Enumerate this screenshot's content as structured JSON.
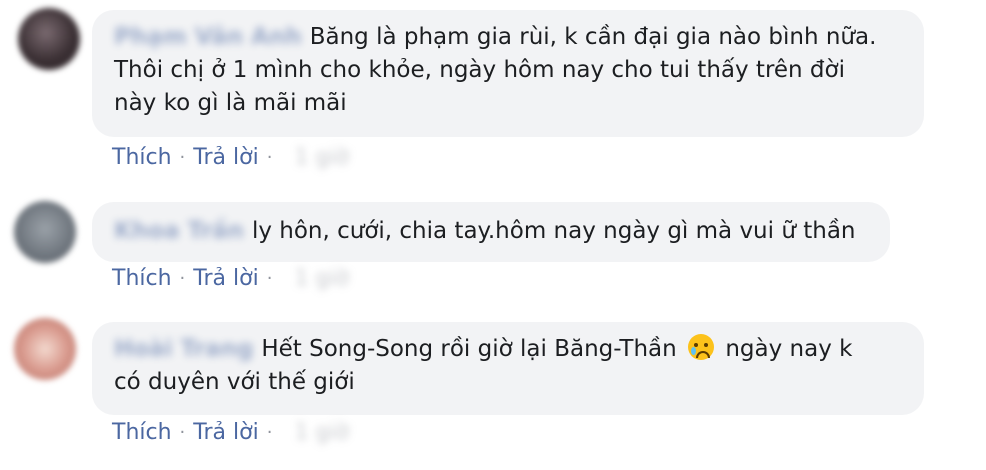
{
  "comments": [
    {
      "author": "Phạm Vân Anh",
      "text_lines": [
        "Băng là phạm gia rùi, k cần đại gia nào bình nữa.",
        "Thôi chị ở 1 mình cho khỏe, ngày hôm nay cho tui thấy trên đời",
        "này ko gì là mãi mãi"
      ],
      "like_label": "Thích",
      "reply_label": "Trả lời",
      "time": "1 giờ"
    },
    {
      "author": "Khoa Trần",
      "text_lines": [
        "ly hôn, cưới, chia tay.hôm nay ngày gì mà vui ữ thần"
      ],
      "like_label": "Thích",
      "reply_label": "Trả lời",
      "time": "1 giờ"
    },
    {
      "author": "Hoài Trang",
      "text_before_emoji": "Hết Song-Song rồi giờ lại Băng-Thần",
      "emoji": "crying-face-icon",
      "text_after_emoji": "ngày nay k",
      "text_line2": "có duyên với thế giới",
      "like_label": "Thích",
      "reply_label": "Trả lời",
      "time": "1 giờ"
    }
  ],
  "separator": "·",
  "colors": {
    "link": "#4b67a1",
    "bubble": "#f2f3f5",
    "text": "#1c1e21"
  }
}
